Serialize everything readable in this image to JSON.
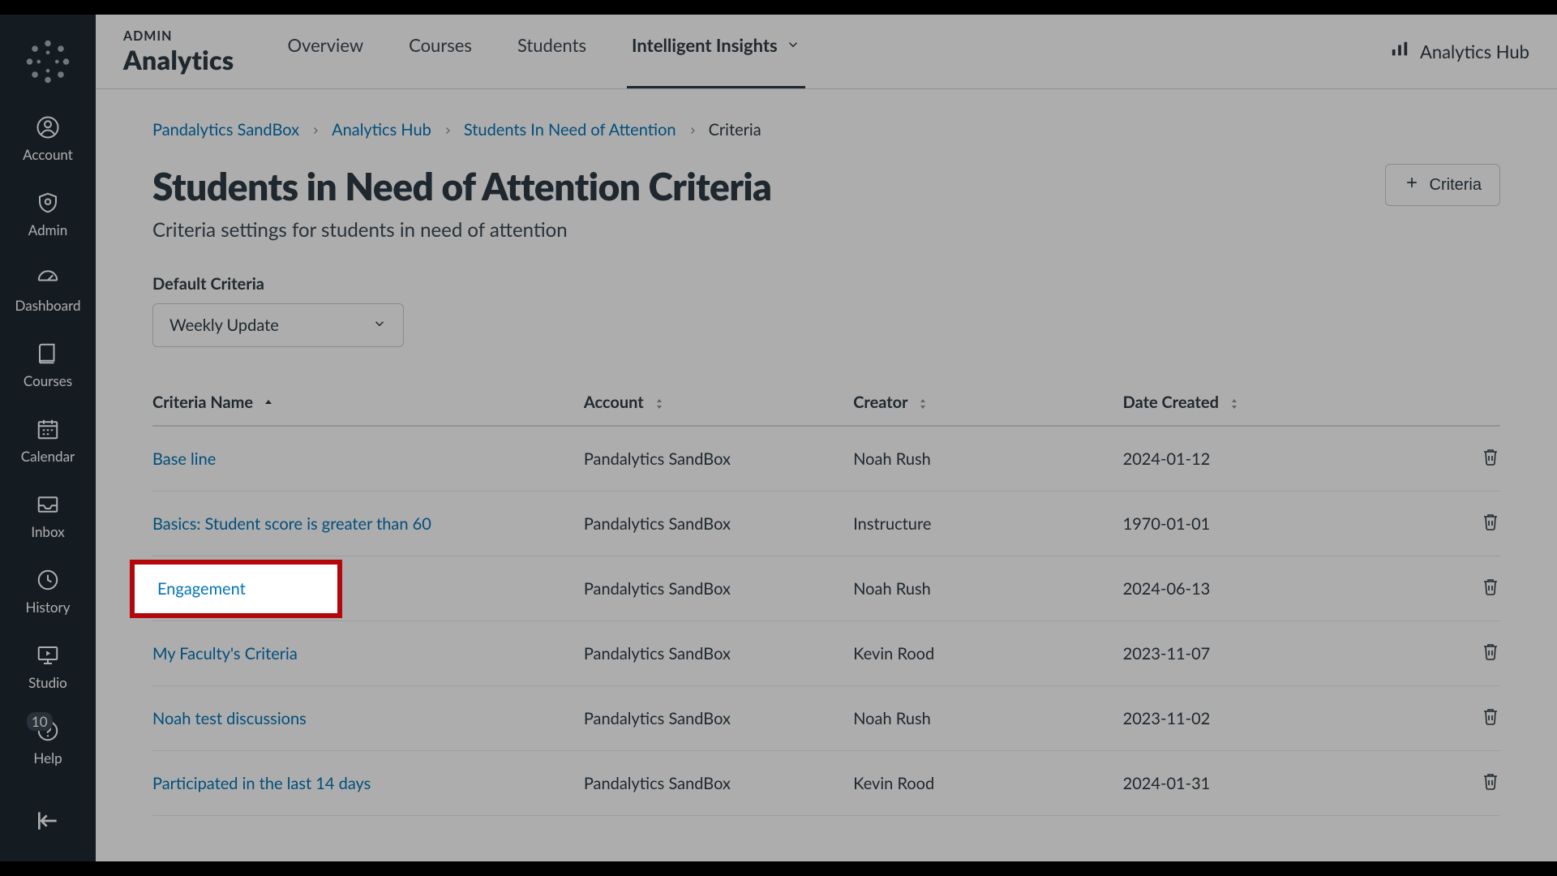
{
  "brand": {
    "small": "ADMIN",
    "large": "Analytics"
  },
  "tabs": [
    {
      "label": "Overview"
    },
    {
      "label": "Courses"
    },
    {
      "label": "Students"
    },
    {
      "label": "Intelligent Insights",
      "active": true,
      "caret": true
    }
  ],
  "hub_link": "Analytics Hub",
  "sidebar": {
    "items": [
      {
        "label": "Account"
      },
      {
        "label": "Admin"
      },
      {
        "label": "Dashboard"
      },
      {
        "label": "Courses"
      },
      {
        "label": "Calendar"
      },
      {
        "label": "Inbox"
      },
      {
        "label": "History"
      },
      {
        "label": "Studio"
      },
      {
        "label": "Help",
        "badge": "10"
      }
    ]
  },
  "breadcrumb": {
    "items": [
      {
        "label": "Pandalytics SandBox",
        "link": true
      },
      {
        "label": "Analytics Hub",
        "link": true
      },
      {
        "label": "Students In Need of Attention",
        "link": true
      },
      {
        "label": "Criteria",
        "link": false
      }
    ]
  },
  "page": {
    "title": "Students in Need of Attention Criteria",
    "subtitle": "Criteria settings for students in need of attention",
    "add_button": "Criteria",
    "default_label": "Default Criteria",
    "default_select_value": "Weekly Update"
  },
  "table": {
    "headers": {
      "name": "Criteria Name",
      "account": "Account",
      "creator": "Creator",
      "date": "Date Created"
    },
    "rows": [
      {
        "name": "Base line",
        "account": "Pandalytics SandBox",
        "creator": "Noah Rush",
        "date": "2024-01-12"
      },
      {
        "name": "Basics: Student score is greater than 60",
        "account": "Pandalytics SandBox",
        "creator": "Instructure",
        "date": "1970-01-01"
      },
      {
        "name": "Engagement",
        "account": "Pandalytics SandBox",
        "creator": "Noah Rush",
        "date": "2024-06-13",
        "highlight": true
      },
      {
        "name": "My Faculty's Criteria",
        "account": "Pandalytics SandBox",
        "creator": "Kevin Rood",
        "date": "2023-11-07"
      },
      {
        "name": "Noah test discussions",
        "account": "Pandalytics SandBox",
        "creator": "Noah Rush",
        "date": "2023-11-02"
      },
      {
        "name": "Participated in the last 14 days",
        "account": "Pandalytics SandBox",
        "creator": "Kevin Rood",
        "date": "2024-01-31"
      }
    ]
  },
  "highlight_text": "Engagement"
}
